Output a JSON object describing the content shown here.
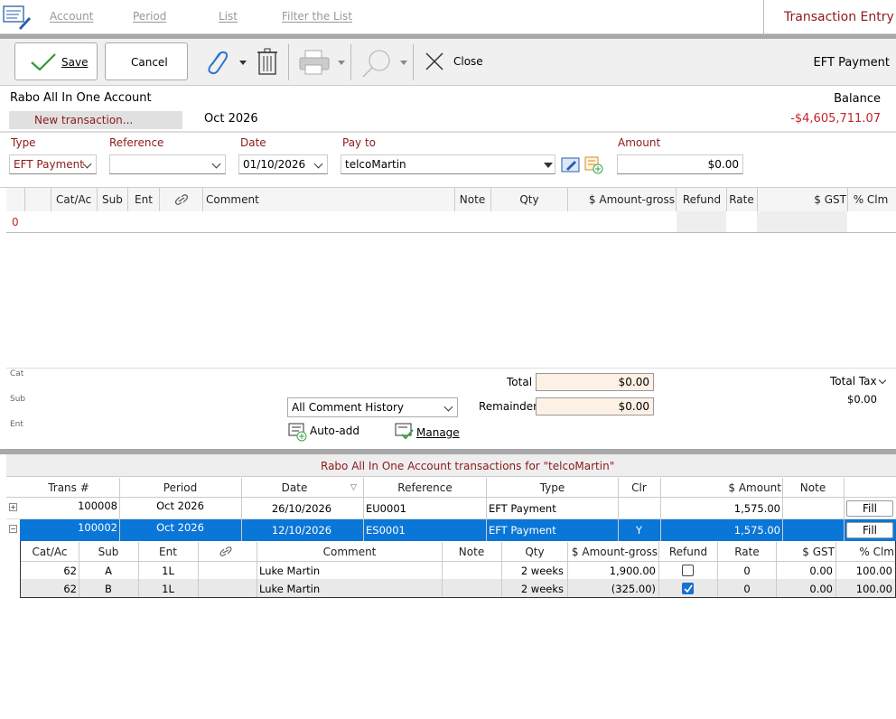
{
  "menu": {
    "account": "Account",
    "period": "Period",
    "list": "List",
    "filter": "Filter the List"
  },
  "window_title": "Transaction Entry",
  "toolbar": {
    "save": "Save",
    "cancel": "Cancel",
    "close": "Close",
    "mode": "EFT Payment"
  },
  "header": {
    "account_name": "Rabo All In One Account",
    "balance_label": "Balance",
    "tab_label": "New transaction...",
    "period": "Oct 2026",
    "balance_value": "-$4,605,711.07"
  },
  "form": {
    "type_label": "Type",
    "type_value": "EFT Payment",
    "reference_label": "Reference",
    "reference_value": "",
    "date_label": "Date",
    "date_value": "01/10/2026",
    "payto_label": "Pay to",
    "payto_value": "telcoMartin",
    "amount_label": "Amount",
    "amount_value": "$0.00"
  },
  "split_grid": {
    "headers": [
      "Cat/Ac",
      "Sub",
      "Ent",
      "Comment",
      "Note",
      "Qty",
      "$ Amount-gross",
      "Refund",
      "Rate",
      "$ GST",
      "% Clm"
    ],
    "row_number": "0"
  },
  "totals": {
    "cat": "Cat",
    "sub": "Sub",
    "ent": "Ent",
    "comment_history": "All Comment History",
    "auto_add": "Auto-add",
    "manage": "Manage",
    "total_label": "Total",
    "total_value": "$0.00",
    "remainder_label": "Remainder",
    "remainder_value": "$0.00",
    "total_tax_label": "Total Tax",
    "total_tax_value": "$0.00"
  },
  "history": {
    "title": "Rabo All In One Account transactions for \"telcoMartin\"",
    "headers": [
      "Trans #",
      "Period",
      "Date",
      "Reference",
      "Type",
      "Clr",
      "$ Amount",
      "Note"
    ],
    "rows": [
      {
        "trans": "100008",
        "period": "Oct 2026",
        "date": "26/10/2026",
        "reference": "EU0001",
        "type": "EFT Payment",
        "clr": "",
        "amount": "1,575.00",
        "note": "",
        "fill": "Fill",
        "expanded": false
      },
      {
        "trans": "100002",
        "period": "Oct 2026",
        "date": "12/10/2026",
        "reference": "ES0001",
        "type": "EFT Payment",
        "clr": "Y",
        "amount": "1,575.00",
        "note": "",
        "fill": "Fill",
        "expanded": true
      }
    ],
    "detail_headers": [
      "Cat/Ac",
      "Sub",
      "Ent",
      "Comment",
      "Note",
      "Qty",
      "$ Amount-gross",
      "Refund",
      "Rate",
      "$ GST",
      "% Clm"
    ],
    "detail_rows": [
      {
        "cat": "62",
        "sub": "A",
        "ent": "1L",
        "comment": "Luke Martin",
        "note": "",
        "qty": "2 weeks",
        "amount": "1,900.00",
        "refund": false,
        "rate": "0",
        "gst": "0.00",
        "clm": "100.00"
      },
      {
        "cat": "62",
        "sub": "B",
        "ent": "1L",
        "comment": "Luke Martin",
        "note": "",
        "qty": "2 weeks",
        "amount": "(325.00)",
        "refund": true,
        "rate": "0",
        "gst": "0.00",
        "clm": "100.00"
      }
    ]
  },
  "colors": {
    "accent_red": "#8b1a1a",
    "selection": "#0a76d8",
    "balance_red": "#c0262b"
  }
}
